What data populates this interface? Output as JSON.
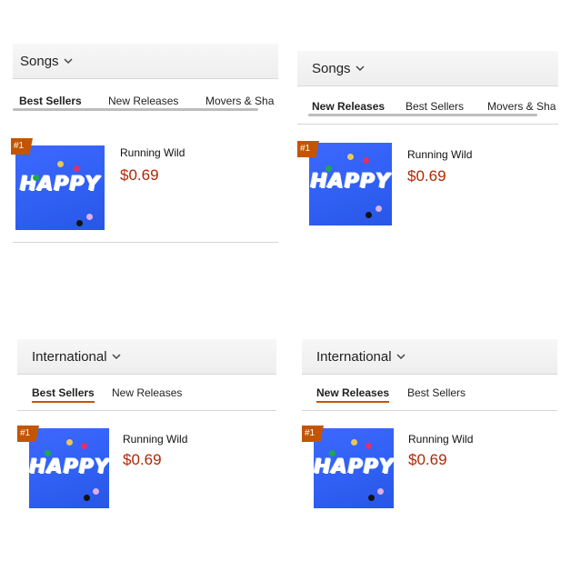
{
  "panels": [
    {
      "title": "Songs",
      "tabs": [
        "Best Sellers",
        "New Releases",
        "Movers & Sha"
      ],
      "active_tab": "Best Sellers",
      "item": {
        "rank": "#1",
        "art_text": "HAPPY",
        "name": "Running Wild",
        "price": "$0.69"
      }
    },
    {
      "title": "Songs",
      "tabs": [
        "New Releases",
        "Best Sellers",
        "Movers & Sha"
      ],
      "active_tab": "New Releases",
      "item": {
        "rank": "#1",
        "art_text": "HAPPY",
        "name": "Running Wild",
        "price": "$0.69"
      }
    },
    {
      "title": "International",
      "tabs": [
        "Best Sellers",
        "New Releases"
      ],
      "active_tab": "Best Sellers",
      "item": {
        "rank": "#1",
        "art_text": "HAPPY",
        "name": "Running Wild",
        "price": "$0.69"
      }
    },
    {
      "title": "International",
      "tabs": [
        "New Releases",
        "Best Sellers"
      ],
      "active_tab": "New Releases",
      "item": {
        "rank": "#1",
        "art_text": "HAPPY",
        "name": "Running Wild",
        "price": "$0.69"
      }
    }
  ],
  "colors": {
    "accent": "#c45500",
    "price": "#b12704",
    "album_blue": "#2f5ff3"
  },
  "icons": {
    "dropdown": "chevron-down-icon"
  }
}
